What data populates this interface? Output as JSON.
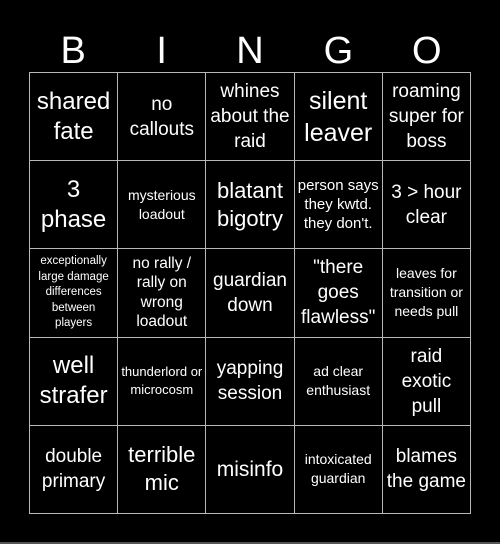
{
  "header": {
    "letters": [
      "B",
      "I",
      "N",
      "G",
      "O"
    ]
  },
  "colors": {
    "background": "#000000",
    "text": "#ffffff",
    "grid_line": "#b8b8b8"
  },
  "grid": {
    "rows": [
      [
        "shared fate",
        "no callouts",
        "whines about the raid",
        "silent leaver",
        "roaming super for boss"
      ],
      [
        "3 phase",
        "mysterious loadout",
        "blatant bigotry",
        "person says they kwtd. they don't.",
        "3 > hour clear"
      ],
      [
        "exceptionally large damage differences between players",
        "no rally / rally on wrong loadout",
        "guardian down",
        "\"there goes flawless\"",
        "leaves for transition or needs pull"
      ],
      [
        "well strafer",
        "thunderlord or microcosm",
        "yapping session",
        "ad clear enthusiast",
        "raid exotic pull"
      ],
      [
        "double primary",
        "terrible mic",
        "misinfo",
        "intoxicated guardian",
        "blames the game"
      ]
    ]
  }
}
